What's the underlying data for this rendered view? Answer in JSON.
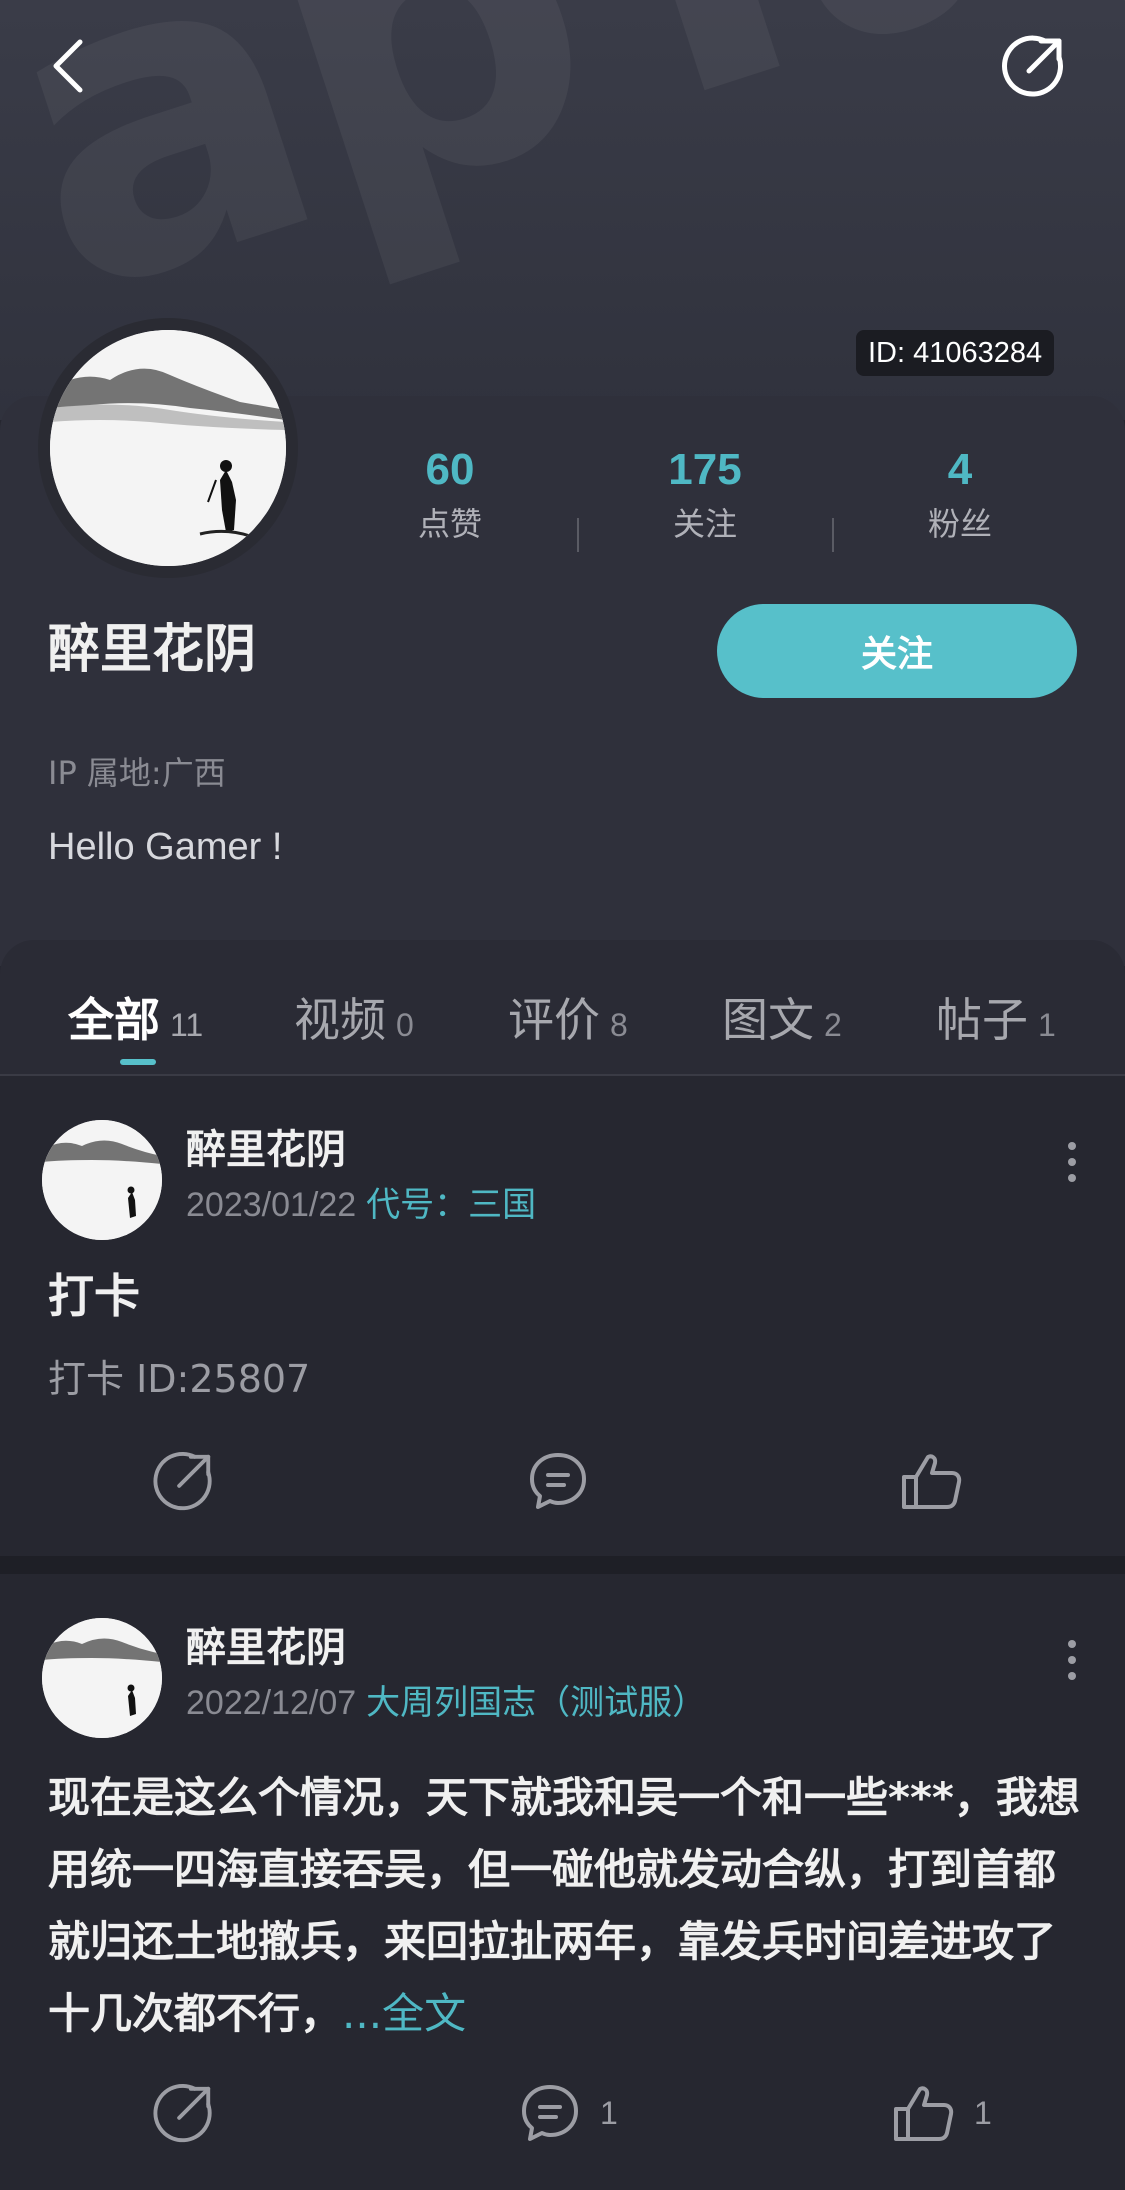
{
  "header": {
    "watermark": "apTap",
    "user_id_badge": "ID: 41063284"
  },
  "profile": {
    "username": "醉里花阴",
    "stats": [
      {
        "value": "60",
        "label": "点赞"
      },
      {
        "value": "175",
        "label": "关注"
      },
      {
        "value": "4",
        "label": "粉丝"
      }
    ],
    "follow_label": "关注",
    "ip_location": "IP 属地:广西",
    "bio": "Hello Gamer !"
  },
  "tabs": [
    {
      "label": "全部",
      "count": "11",
      "active": true
    },
    {
      "label": "视频",
      "count": "0",
      "active": false
    },
    {
      "label": "评价",
      "count": "8",
      "active": false
    },
    {
      "label": "图文",
      "count": "2",
      "active": false
    },
    {
      "label": "帖子",
      "count": "1",
      "active": false
    }
  ],
  "posts": [
    {
      "author": "醉里花阴",
      "date": "2023/01/22",
      "game": "代号：三国",
      "title": "打卡",
      "body": "打卡 ID:25807",
      "comments": "",
      "likes": ""
    },
    {
      "author": "醉里花阴",
      "date": "2022/12/07",
      "game": "大周列国志（测试服）",
      "text": "现在是这么个情况，天下就我和吴一个和一些***，我想用统一四海直接吞吴，但一碰他就发动合纵，打到首都就归还土地撤兵，来回拉扯两年，靠发兵时间差进攻了十几次都不行，",
      "read_more": "...全文",
      "comments": "1",
      "likes": "1"
    }
  ],
  "colors": {
    "accent": "#57c0ca",
    "accent_text": "#4fb8c4",
    "background": "#262730",
    "panel": "#2f303b"
  },
  "icons": {
    "back": "chevron-left-icon",
    "share": "share-icon",
    "comment": "comment-icon",
    "like": "thumbs-up-icon",
    "more": "more-vertical-icon"
  }
}
